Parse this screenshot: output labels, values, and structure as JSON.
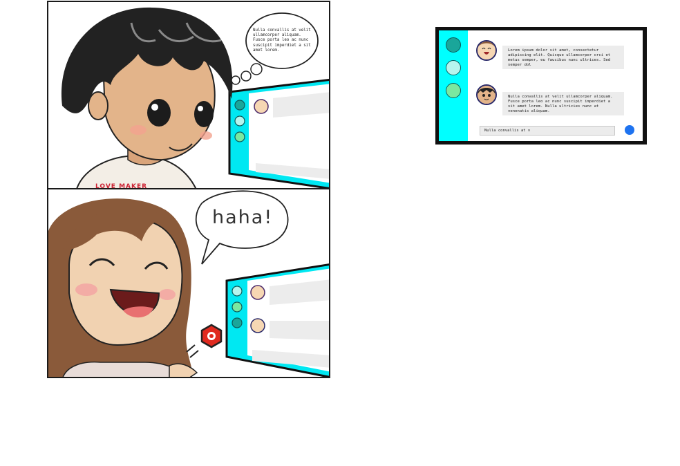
{
  "comic": {
    "thought_bubble_text": "Nulla convallis at velit ullamcorper aliquam. Fusce porta leo ac nunc suscipit imperdiet a sit amet lorem.",
    "speech_bubble_text": "haha!",
    "shirt_text": "LOVE MAKER"
  },
  "chat": {
    "message1": "Lorem ipsum dolor sit amet, consectetur adipiscing elit. Quisque ullamcorper orci et metus semper, eu faucibus nunc ultrices. Sed semper dol",
    "message2": "Nulla convallis at velit ullamcorper aliquam. Fusce porta leo ac nunc suscipit imperdiet a sit amet lorem. Nulla ultricies nunc at venenatis aliquam.",
    "input_value": "Nulla convallis at v",
    "sidebar_colors": [
      "#1aa69a",
      "#b5f5ee",
      "#7ae8a0"
    ],
    "accent_color": "#00ffff",
    "send_color": "#1e73f0"
  }
}
